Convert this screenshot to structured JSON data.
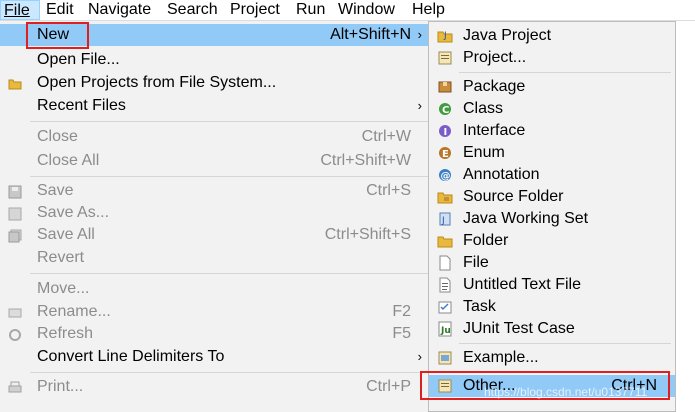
{
  "menubar": {
    "items": [
      {
        "label": "File",
        "underline": "F"
      },
      {
        "label": "Edit",
        "underline": "E"
      },
      {
        "label": "Navigate",
        "underline": "N"
      },
      {
        "label": "Search",
        "underline": "a"
      },
      {
        "label": "Project",
        "underline": "P"
      },
      {
        "label": "Run",
        "underline": "R"
      },
      {
        "label": "Window",
        "underline": "W"
      },
      {
        "label": "Help",
        "underline": "H"
      }
    ]
  },
  "file_menu": {
    "new": {
      "label": "New",
      "shortcut": "Alt+Shift+N"
    },
    "open_file": {
      "label": "Open File..."
    },
    "open_projects": {
      "label": "Open Projects from File System..."
    },
    "recent_files": {
      "label": "Recent Files"
    },
    "close": {
      "label": "Close",
      "shortcut": "Ctrl+W"
    },
    "close_all": {
      "label": "Close All",
      "shortcut": "Ctrl+Shift+W"
    },
    "save": {
      "label": "Save",
      "shortcut": "Ctrl+S"
    },
    "save_as": {
      "label": "Save As..."
    },
    "save_all": {
      "label": "Save All",
      "shortcut": "Ctrl+Shift+S"
    },
    "revert": {
      "label": "Revert"
    },
    "move": {
      "label": "Move..."
    },
    "rename": {
      "label": "Rename...",
      "shortcut": "F2"
    },
    "refresh": {
      "label": "Refresh",
      "shortcut": "F5"
    },
    "convert": {
      "label": "Convert Line Delimiters To"
    },
    "print": {
      "label": "Print...",
      "shortcut": "Ctrl+P"
    }
  },
  "new_submenu": {
    "java_project": "Java Project",
    "project": "Project...",
    "package": "Package",
    "class": "Class",
    "interface": "Interface",
    "enum": "Enum",
    "annotation": "Annotation",
    "source_folder": "Source Folder",
    "java_working_set": "Java Working Set",
    "folder": "Folder",
    "file": "File",
    "untitled_text_file": "Untitled Text File",
    "task": "Task",
    "junit_test_case": "JUnit Test Case",
    "example": "Example...",
    "other": {
      "label": "Other...",
      "shortcut": "Ctrl+N"
    }
  },
  "watermark": "https://blog.csdn.net/u0137711",
  "colors": {
    "highlight": "#91c9f7",
    "annotation_box": "#e02020",
    "menu_bg": "#f2f2f2"
  }
}
